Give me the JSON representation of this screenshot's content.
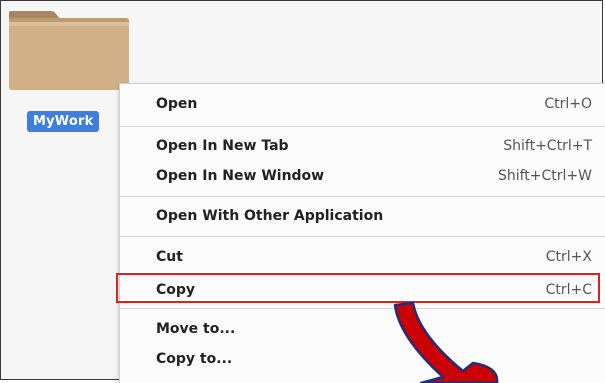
{
  "file": {
    "label": "MyWork"
  },
  "menu": {
    "items": [
      {
        "label": "Open",
        "shortcut": "Ctrl+O"
      },
      {
        "label": "Open In New Tab",
        "shortcut": "Shift+Ctrl+T"
      },
      {
        "label": "Open In New Window",
        "shortcut": "Shift+Ctrl+W"
      },
      {
        "label": "Open With Other Application",
        "shortcut": ""
      },
      {
        "label": "Cut",
        "shortcut": "Ctrl+X"
      },
      {
        "label": "Copy",
        "shortcut": "Ctrl+C"
      },
      {
        "label": "Move to...",
        "shortcut": ""
      },
      {
        "label": "Copy to...",
        "shortcut": ""
      }
    ]
  },
  "colors": {
    "selection": "#3d7ede",
    "highlight_box": "#d42424",
    "arrow": "#cc0000",
    "folder": "#c9a77c"
  },
  "icons": {
    "folder": "folder-icon",
    "pointer": "arrow-icon"
  }
}
